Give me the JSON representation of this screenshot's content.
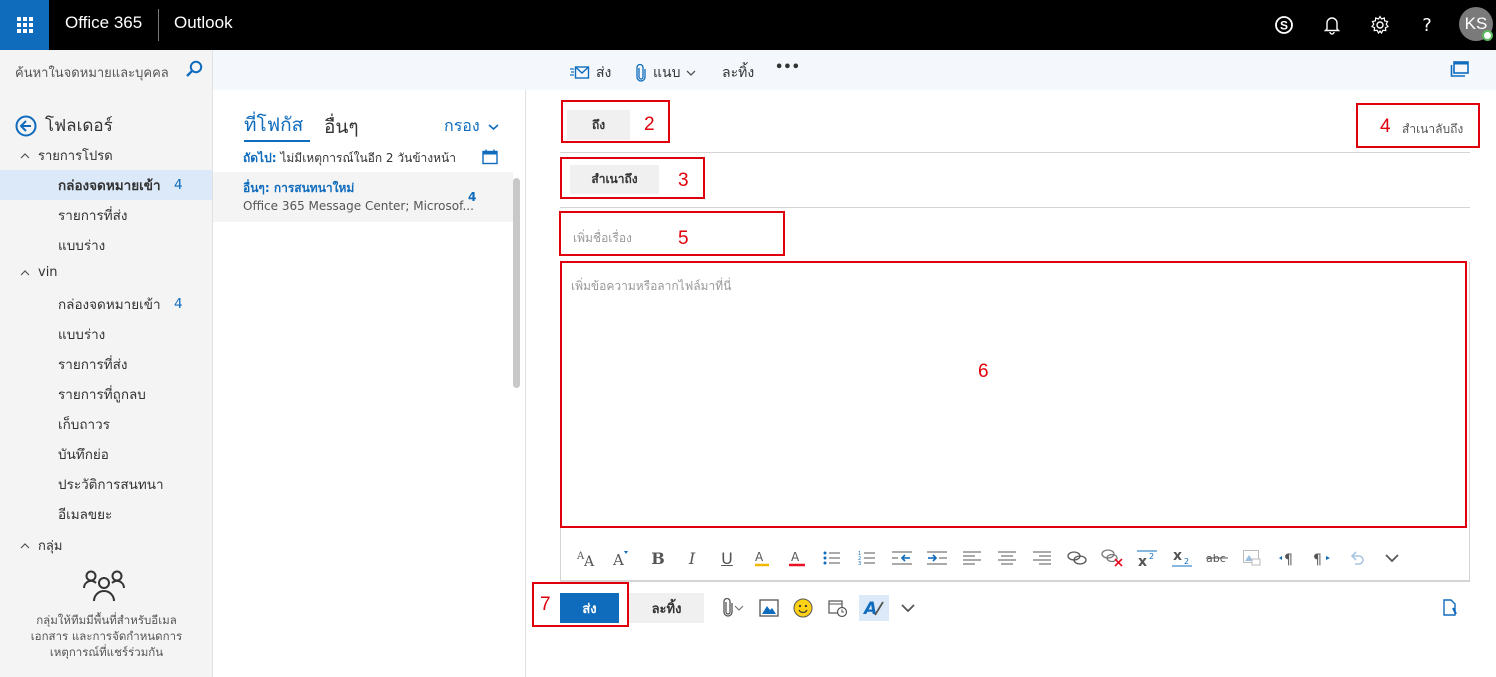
{
  "topbar": {
    "suite_name": "Office 365",
    "app_name": "Outlook",
    "avatar_initials": "KS",
    "icons": [
      "skype-icon",
      "bell-icon",
      "gear-icon",
      "help-icon"
    ],
    "help_glyph": "?"
  },
  "search": {
    "placeholder": "ค้นหาในจดหมายและบุคคล"
  },
  "commandbar": {
    "send_label": "ส่ง",
    "attach_label": "แนบ",
    "discard_label": "ละทิ้ง",
    "more_glyph": "•••"
  },
  "leftnav": {
    "back_label": "โฟลเดอร์",
    "favorites_label": "รายการโปรด",
    "favorites": [
      {
        "label": "กล่องจดหมายเข้า",
        "count": "4",
        "selected": true
      },
      {
        "label": "รายการที่ส่ง",
        "count": ""
      },
      {
        "label": "แบบร่าง",
        "count": ""
      }
    ],
    "account_label": "vin",
    "account_folders": [
      {
        "label": "กล่องจดหมายเข้า",
        "count": "4"
      },
      {
        "label": "แบบร่าง",
        "count": ""
      },
      {
        "label": "รายการที่ส่ง",
        "count": ""
      },
      {
        "label": "รายการที่ถูกลบ",
        "count": ""
      },
      {
        "label": "เก็บถาวร",
        "count": ""
      },
      {
        "label": "บันทึกย่อ",
        "count": ""
      },
      {
        "label": "ประวัติการสนทนา",
        "count": ""
      },
      {
        "label": "อีเมลขยะ",
        "count": ""
      }
    ],
    "groups_label": "กลุ่ม",
    "groups_desc_lines": [
      "กลุ่มให้ทีมมีพื้นที่สำหรับอีเมล",
      "เอกสาร และการจัดกำหนดการ",
      "เหตุการณ์ที่แชร์ร่วมกัน"
    ]
  },
  "messagelist": {
    "tab_focused": "ที่โฟกัส",
    "tab_other": "อื่นๆ",
    "filter_label": "กรอง",
    "next_prefix": "ถัดไป:",
    "next_text": "ไม่มีเหตุการณ์ในอีก 2 วันข้างหน้า",
    "messages": [
      {
        "title": "อื่นๆ: การสนทนาใหม่",
        "from": "Office 365 Message Center; Microsof...",
        "count": "4"
      }
    ]
  },
  "compose": {
    "to_label": "ถึง",
    "cc_label": "สำเนาถึง",
    "bcc_label": "สำเนาลับถึง",
    "subject_placeholder": "เพิ่มชื่อเรื่อง",
    "body_placeholder": "เพิ่มข้อความหรือลากไฟล์มาที่นี่",
    "send_label": "ส่ง",
    "discard_label": "ละทิ้ง",
    "format_tools": [
      "font-size-icon",
      "font-grow-icon",
      "bold-icon",
      "italic-icon",
      "underline-icon",
      "highlight-icon",
      "font-color-icon",
      "bullets-icon",
      "numbering-icon",
      "outdent-icon",
      "indent-icon",
      "align-left-icon",
      "align-center-icon",
      "align-right-icon",
      "link-icon",
      "unlink-icon",
      "superscript-icon",
      "subscript-icon",
      "strikethrough-icon",
      "image-inline-icon",
      "ltr-icon",
      "rtl-icon",
      "undo-icon",
      "more-chevron-icon"
    ]
  },
  "annotations": {
    "to": "2",
    "cc": "3",
    "bcc": "4",
    "subject": "5",
    "body": "6",
    "send": "7",
    "color": "#e0000b"
  },
  "colors": {
    "accent": "#0f6cbd",
    "topbar": "#000000",
    "nav_bg": "#f4f4f4",
    "selected_bg": "#dbe9f8"
  }
}
